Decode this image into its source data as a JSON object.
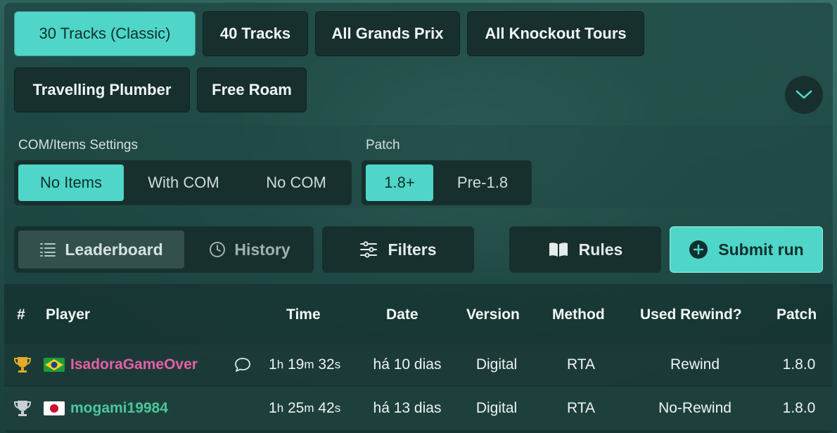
{
  "categories": [
    {
      "label": "30 Tracks (Classic)",
      "active": true
    },
    {
      "label": "40 Tracks",
      "active": false
    },
    {
      "label": "All Grands Prix",
      "active": false
    },
    {
      "label": "All Knockout Tours",
      "active": false
    },
    {
      "label": "Travelling Plumber",
      "active": false
    },
    {
      "label": "Free Roam",
      "active": false
    }
  ],
  "settings": {
    "com_items": {
      "label": "COM/Items Settings",
      "options": [
        "No Items",
        "With COM",
        "No COM"
      ],
      "selected": "No Items"
    },
    "patch": {
      "label": "Patch",
      "options": [
        "1.8+",
        "Pre-1.8"
      ],
      "selected": "1.8+"
    }
  },
  "view": {
    "leaderboard_label": "Leaderboard",
    "history_label": "History",
    "active": "Leaderboard"
  },
  "actions": {
    "filters_label": "Filters",
    "rules_label": "Rules",
    "submit_label": "Submit run"
  },
  "table": {
    "headers": {
      "rank": "#",
      "player": "Player",
      "time": "Time",
      "date": "Date",
      "version": "Version",
      "method": "Method",
      "rewind": "Used Rewind?",
      "patch": "Patch"
    },
    "rows": [
      {
        "rank_icon": "gold-trophy-icon",
        "country": "Brazil",
        "player": "IsadoraGameOver",
        "player_color": "#e75fa8",
        "has_comment": true,
        "time": {
          "h": "1",
          "m": "19",
          "s": "32",
          "h_unit": "h",
          "m_unit": "m",
          "s_unit": "s"
        },
        "date": "há 10 dias",
        "version": "Digital",
        "method": "RTA",
        "rewind": "Rewind",
        "patch": "1.8.0"
      },
      {
        "rank_icon": "silver-trophy-icon",
        "country": "Japan",
        "player": "mogami19984",
        "player_color": "#4cc79a",
        "has_comment": false,
        "time": {
          "h": "1",
          "m": "25",
          "s": "42",
          "h_unit": "h",
          "m_unit": "m",
          "s_unit": "s"
        },
        "date": "há 13 dias",
        "version": "Digital",
        "method": "RTA",
        "rewind": "No-Rewind",
        "patch": "1.8.0"
      }
    ]
  },
  "colors": {
    "accent": "#4fd6c8",
    "button_dark": "#17302e",
    "gold": "#e2a92a",
    "silver": "#c9cfd4"
  }
}
